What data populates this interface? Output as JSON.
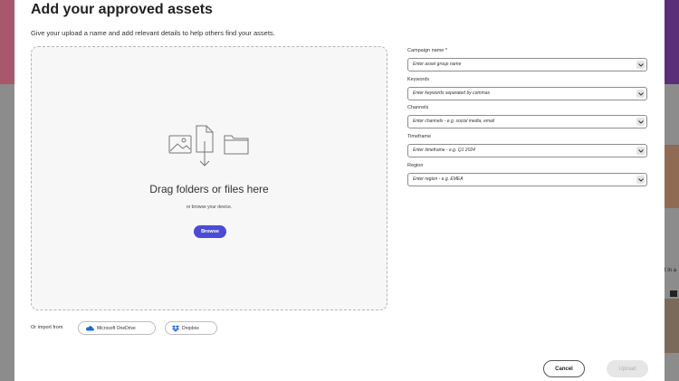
{
  "modal": {
    "title": "Add your approved assets",
    "subtitle": "Give your upload a name and add relevant details to help others find your assets."
  },
  "dropzone": {
    "title": "Drag folders or files here",
    "subtitle": "or browse your device.",
    "browse_label": "Browse"
  },
  "import": {
    "label": "Or import from",
    "onedrive_label": "Microsoft OneDrive",
    "dropbox_label": "Dropbox"
  },
  "form": {
    "campaign": {
      "label": "Campaign name *",
      "placeholder": "Enter asset group name"
    },
    "keywords": {
      "label": "Keywords",
      "placeholder": "Enter keywords separated by commas"
    },
    "channels": {
      "label": "Channels",
      "placeholder": "Enter channels - e.g. social media, email"
    },
    "timeframe": {
      "label": "Timeframe",
      "placeholder": "Enter timeframe - e.g. Q1 2024"
    },
    "region": {
      "label": "Region",
      "placeholder": "Enter region - e.g. EMEA"
    }
  },
  "footer": {
    "cancel_label": "Cancel",
    "upload_label": "Upload"
  },
  "background": {
    "partial_text": "t in a"
  },
  "colors": {
    "accent": "#4b4bd6",
    "onedrive": "#1c6fd1",
    "dropbox": "#1b57e6"
  }
}
